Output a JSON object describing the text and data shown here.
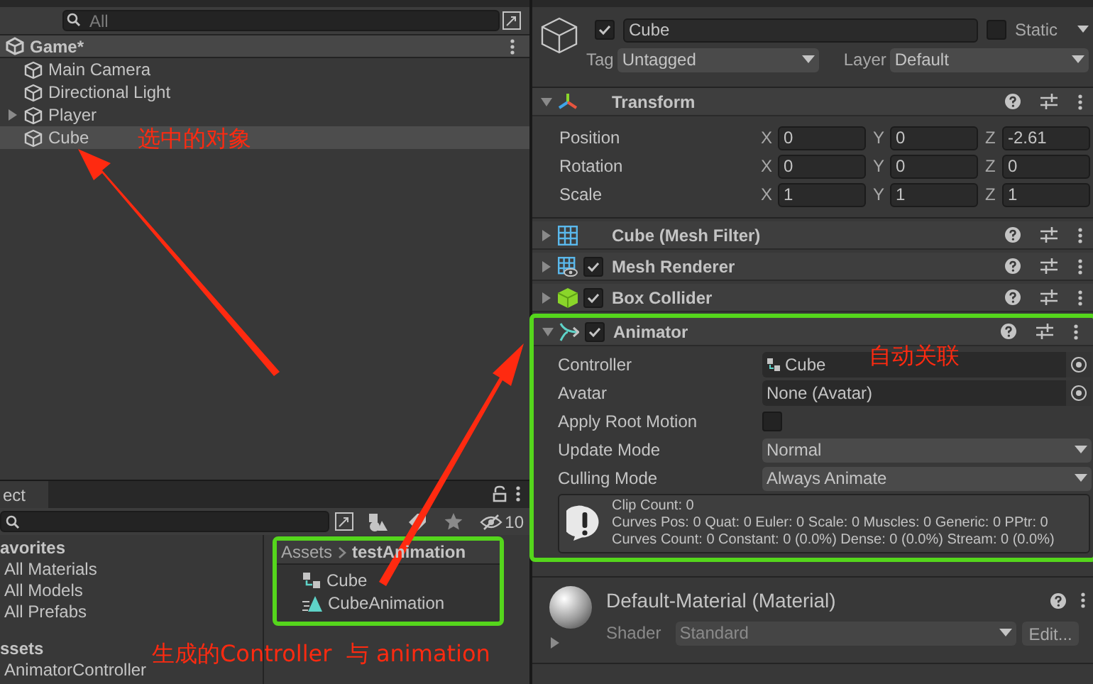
{
  "hierarchy": {
    "search": {
      "placeholder": "All"
    },
    "scene": "Game*",
    "items": [
      {
        "label": "Main Camera",
        "has_children": false,
        "selected": false
      },
      {
        "label": "Directional Light",
        "has_children": false,
        "selected": false
      },
      {
        "label": "Player",
        "has_children": true,
        "selected": false
      },
      {
        "label": "Cube",
        "has_children": false,
        "selected": true
      }
    ]
  },
  "project": {
    "tab": "ect",
    "hidden_count": "10",
    "tree": [
      {
        "label": "avorites",
        "kind": "header"
      },
      {
        "label": "All Materials",
        "kind": "item"
      },
      {
        "label": "All Models",
        "kind": "item"
      },
      {
        "label": "All Prefabs",
        "kind": "item"
      },
      {
        "label": "ssets",
        "kind": "header"
      },
      {
        "label": "AnimatorController",
        "kind": "item"
      }
    ],
    "breadcrumb": [
      "Assets",
      "testAnimation"
    ],
    "assets": [
      {
        "label": "Cube",
        "kind": "controller"
      },
      {
        "label": "CubeAnimation",
        "kind": "clip"
      }
    ]
  },
  "inspector": {
    "active": true,
    "name": "Cube",
    "static": false,
    "static_label": "Static",
    "tag_label": "Tag",
    "tag": "Untagged",
    "layer_label": "Layer",
    "layer": "Default",
    "transform": {
      "title": "Transform",
      "expanded": true,
      "rows": [
        {
          "label": "Position",
          "axes": [
            "X",
            "Y",
            "Z"
          ],
          "values": [
            "0",
            "0",
            "-2.61"
          ]
        },
        {
          "label": "Rotation",
          "axes": [
            "X",
            "Y",
            "Z"
          ],
          "values": [
            "0",
            "0",
            "0"
          ]
        },
        {
          "label": "Scale",
          "axes": [
            "X",
            "Y",
            "Z"
          ],
          "values": [
            "1",
            "1",
            "1"
          ]
        }
      ]
    },
    "components": [
      {
        "name": "Cube (Mesh Filter)",
        "kind": "mesh_filter",
        "expanded": false
      },
      {
        "name": "Mesh Renderer",
        "kind": "mesh_renderer",
        "expanded": false,
        "enabled": true
      },
      {
        "name": "Box Collider",
        "kind": "box_collider",
        "expanded": false,
        "enabled": true
      },
      {
        "name": "Animator",
        "kind": "animator",
        "expanded": true,
        "enabled": true
      }
    ],
    "animator_fields": [
      {
        "label": "Controller",
        "kind": "object",
        "value": "Cube",
        "has_icon": true
      },
      {
        "label": "Avatar",
        "kind": "object",
        "value": "None (Avatar)",
        "has_icon": false
      },
      {
        "label": "Apply Root Motion",
        "kind": "checkbox",
        "checked": false
      },
      {
        "label": "Update Mode",
        "kind": "dropdown",
        "value": "Normal"
      },
      {
        "label": "Culling Mode",
        "kind": "dropdown",
        "value": "Always Animate"
      }
    ],
    "info_lines": [
      "Clip Count: 0",
      "Curves Pos: 0 Quat: 0 Euler: 0 Scale: 0 Muscles: 0 Generic: 0 PPtr: 0",
      "Curves Count: 0 Constant: 0 (0.0%) Dense: 0 (0.0%) Stream: 0 (0.0%)"
    ],
    "material": {
      "name": "Default-Material (Material)",
      "shader_label": "Shader",
      "shader": "Standard",
      "edit": "Edit..."
    }
  },
  "annotations": [
    "选中的对象",
    "自动关联",
    "生成的Controller  与 animation"
  ]
}
